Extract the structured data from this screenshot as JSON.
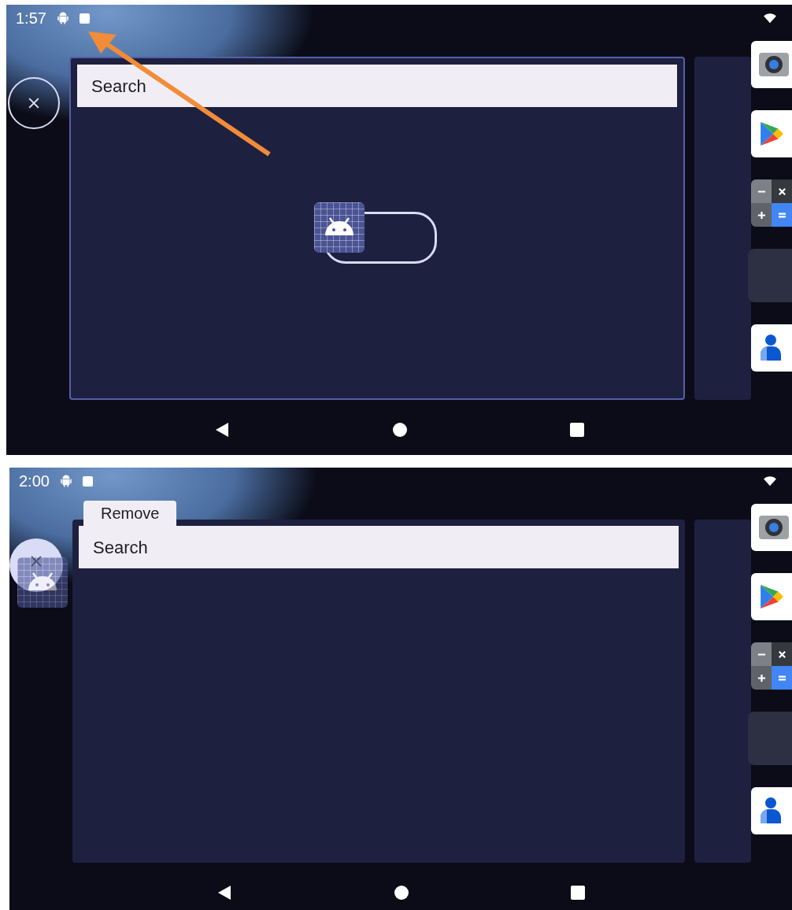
{
  "screens": [
    {
      "kind": "dragging",
      "time": "1:57",
      "search_label": "Search",
      "arrow_annotation": true,
      "dock": [
        {
          "kind": "camera"
        },
        {
          "kind": "store"
        },
        {
          "kind": "calculator"
        },
        {
          "kind": "blank"
        },
        {
          "kind": "contacts"
        }
      ]
    },
    {
      "kind": "removing",
      "time": "2:00",
      "search_label": "Search",
      "remove_label": "Remove",
      "arrow_annotation": false,
      "dock": [
        {
          "kind": "camera"
        },
        {
          "kind": "store"
        },
        {
          "kind": "calculator"
        },
        {
          "kind": "blank"
        },
        {
          "kind": "contacts"
        }
      ]
    }
  ]
}
